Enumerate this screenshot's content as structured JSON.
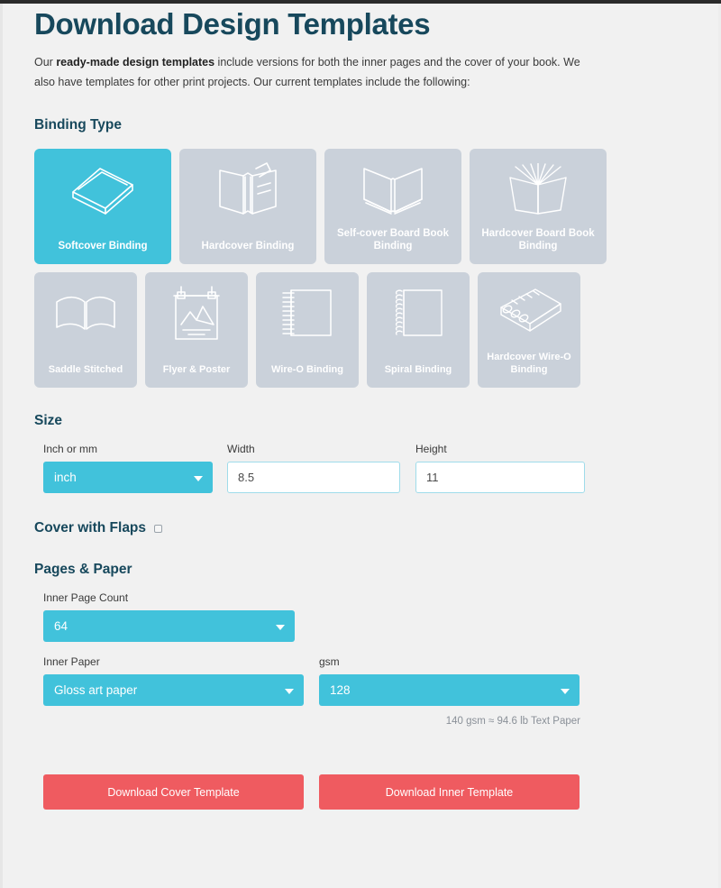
{
  "header": {
    "title": "Download Design Templates",
    "intro_before": "Our ",
    "intro_bold": "ready-made design templates",
    "intro_after": " include versions for both the inner pages and the cover of your book. We also have templates for other print projects. Our current templates include the following:"
  },
  "binding": {
    "section_title": "Binding Type",
    "row1": [
      {
        "label": "Softcover Binding",
        "icon": "softcover-book-icon",
        "selected": true
      },
      {
        "label": "Hardcover Binding",
        "icon": "hardcover-book-icon",
        "selected": false
      },
      {
        "label": "Self-cover Board Book Binding",
        "icon": "board-book-icon",
        "selected": false
      },
      {
        "label": "Hardcover Board Book Binding",
        "icon": "fanned-board-book-icon",
        "selected": false
      }
    ],
    "row2": [
      {
        "label": "Saddle Stitched",
        "icon": "open-book-icon",
        "selected": false
      },
      {
        "label": "Flyer & Poster",
        "icon": "poster-icon",
        "selected": false
      },
      {
        "label": "Wire-O Binding",
        "icon": "wire-o-icon",
        "selected": false
      },
      {
        "label": "Spiral Binding",
        "icon": "spiral-icon",
        "selected": false
      },
      {
        "label": "Hardcover Wire-O Binding",
        "icon": "hardcover-wire-o-icon",
        "selected": false
      }
    ]
  },
  "size": {
    "section_title": "Size",
    "unit_label": "Inch or mm",
    "unit_value": "inch",
    "width_label": "Width",
    "width_value": "8.5",
    "height_label": "Height",
    "height_value": "11"
  },
  "flaps": {
    "title": "Cover with Flaps",
    "checked": false
  },
  "pages": {
    "section_title": "Pages & Paper",
    "page_count_label": "Inner Page Count",
    "page_count_value": "64",
    "inner_paper_label": "Inner Paper",
    "inner_paper_value": "Gloss art paper",
    "gsm_label": "gsm",
    "gsm_value": "128",
    "note": "140 gsm ≈ 94.6 lb Text Paper"
  },
  "actions": {
    "download_cover": "Download Cover Template",
    "download_inner": "Download Inner Template"
  },
  "colors": {
    "accent": "#41c2db",
    "tile_idle": "#cad1da",
    "danger": "#ef5b60",
    "heading": "#17485c",
    "background": "#f1f1f1"
  }
}
